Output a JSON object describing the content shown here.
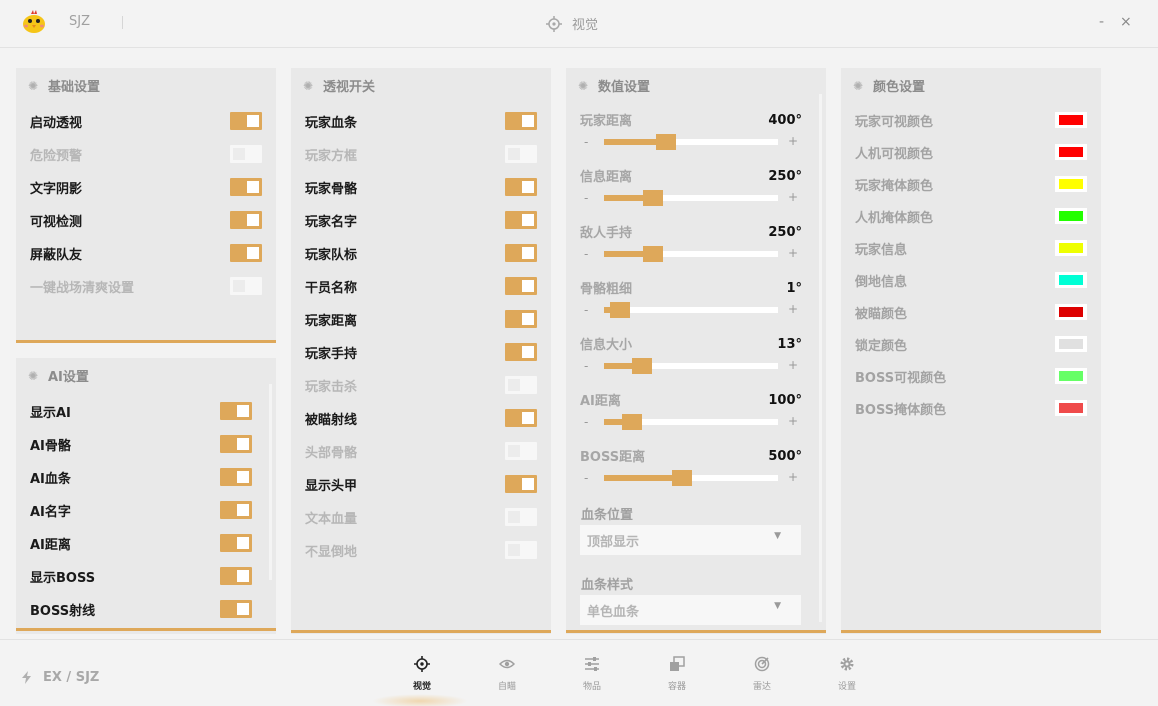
{
  "titlebar": {
    "app_name": "SJZ",
    "title": "视觉",
    "minimize": "-",
    "close": "×"
  },
  "colors": {
    "accent": "#dea85a",
    "panel_bg": "#e9e9e9",
    "toggle_off": "#f7f7f7"
  },
  "basic": {
    "title": "基础设置",
    "items": [
      {
        "label": "启动透视",
        "on": true
      },
      {
        "label": "危险预警",
        "on": false
      },
      {
        "label": "文字阴影",
        "on": true
      },
      {
        "label": "可视检测",
        "on": true
      },
      {
        "label": "屏蔽队友",
        "on": true
      },
      {
        "label": "一键战场清爽设置",
        "on": false
      }
    ]
  },
  "ai": {
    "title": "AI设置",
    "items": [
      {
        "label": "显示AI",
        "on": true
      },
      {
        "label": "AI骨骼",
        "on": true
      },
      {
        "label": "AI血条",
        "on": true
      },
      {
        "label": "AI名字",
        "on": true
      },
      {
        "label": "AI距离",
        "on": true
      },
      {
        "label": "显示BOSS",
        "on": true
      },
      {
        "label": "BOSS射线",
        "on": true
      }
    ]
  },
  "esp": {
    "title": "透视开关",
    "items": [
      {
        "label": "玩家血条",
        "on": true
      },
      {
        "label": "玩家方框",
        "on": false
      },
      {
        "label": "玩家骨骼",
        "on": true
      },
      {
        "label": "玩家名字",
        "on": true
      },
      {
        "label": "玩家队标",
        "on": true
      },
      {
        "label": "干员名称",
        "on": true
      },
      {
        "label": "玩家距离",
        "on": true
      },
      {
        "label": "玩家手持",
        "on": true
      },
      {
        "label": "玩家击杀",
        "on": false
      },
      {
        "label": "被瞄射线",
        "on": true
      },
      {
        "label": "头部骨骼",
        "on": false
      },
      {
        "label": "显示头甲",
        "on": true
      },
      {
        "label": "文本血量",
        "on": false
      },
      {
        "label": "不显倒地",
        "on": false
      }
    ]
  },
  "values": {
    "title": "数值设置",
    "sliders": [
      {
        "label": "玩家距离",
        "value": "400°",
        "fraction": 0.34
      },
      {
        "label": "信息距离",
        "value": "250°",
        "fraction": 0.25
      },
      {
        "label": "敌人手持",
        "value": "250°",
        "fraction": 0.25
      },
      {
        "label": "骨骼粗细",
        "value": "1°",
        "fraction": 0.04
      },
      {
        "label": "信息大小",
        "value": "13°",
        "fraction": 0.18
      },
      {
        "label": "AI距离",
        "value": "100°",
        "fraction": 0.12
      },
      {
        "label": "BOSS距离",
        "value": "500°",
        "fraction": 0.44
      }
    ],
    "minus": "-",
    "plus": "+",
    "dropdowns": [
      {
        "label": "血条位置",
        "value": "顶部显示"
      },
      {
        "label": "血条样式",
        "value": "单色血条"
      }
    ]
  },
  "color_settings": {
    "title": "颜色设置",
    "items": [
      {
        "label": "玩家可视颜色",
        "color": "#ff0000"
      },
      {
        "label": "人机可视颜色",
        "color": "#ff0000"
      },
      {
        "label": "玩家掩体颜色",
        "color": "#ffff00"
      },
      {
        "label": "人机掩体颜色",
        "color": "#22ff00"
      },
      {
        "label": "玩家信息",
        "color": "#eeff00"
      },
      {
        "label": "倒地信息",
        "color": "#00ffd5"
      },
      {
        "label": "被瞄颜色",
        "color": "#dd0000"
      },
      {
        "label": "锁定颜色",
        "color": "#e0e0e0"
      },
      {
        "label": "BOSS可视颜色",
        "color": "#66ff66"
      },
      {
        "label": "BOSS掩体颜色",
        "color": "#ef4a4a"
      }
    ]
  },
  "footer": {
    "brand": "EX / SJZ",
    "nav": [
      {
        "label": "视觉",
        "icon": "crosshair-icon",
        "active": true
      },
      {
        "label": "自瞄",
        "icon": "eye-icon",
        "active": false
      },
      {
        "label": "物品",
        "icon": "sliders-icon",
        "active": false
      },
      {
        "label": "容器",
        "icon": "container-icon",
        "active": false
      },
      {
        "label": "雷达",
        "icon": "radar-icon",
        "active": false
      },
      {
        "label": "设置",
        "icon": "gear-icon",
        "active": false
      }
    ]
  }
}
